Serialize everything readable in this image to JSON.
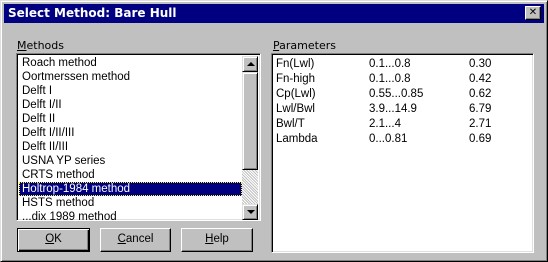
{
  "window": {
    "title": "Select Method: Bare Hull",
    "close_glyph": "✕"
  },
  "methods": {
    "label_accel": "M",
    "label_rest": "ethods",
    "items": [
      "Roach method",
      "Oortmerssen method",
      "Delft I",
      "Delft I/II",
      "Delft II",
      "Delft I/II/III",
      "Delft II/III",
      "USNA YP series",
      "CRTS method",
      "Holtrop-1984 method",
      "HSTS method",
      "...dix 1989 method"
    ],
    "selected_index": 9
  },
  "parameters": {
    "label_accel": "P",
    "label_rest": "arameters",
    "rows": [
      {
        "name": "Fn(Lwl)",
        "range": "0.1...0.8",
        "value": "0.30"
      },
      {
        "name": "Fn-high",
        "range": "0.1...0.8",
        "value": "0.42"
      },
      {
        "name": "Cp(Lwl)",
        "range": "0.55...0.85",
        "value": "0.62"
      },
      {
        "name": "Lwl/Bwl",
        "range": "3.9...14.9",
        "value": "6.79"
      },
      {
        "name": "Bwl/T",
        "range": "2.1...4",
        "value": "2.71"
      },
      {
        "name": "Lambda",
        "range": "0...0.81",
        "value": "0.69"
      }
    ]
  },
  "buttons": {
    "ok": {
      "accel": "O",
      "rest": "K"
    },
    "cancel": {
      "accel": "C",
      "rest": "ancel"
    },
    "help": {
      "accel": "H",
      "rest": "elp"
    }
  },
  "colors": {
    "titlebar": "#000080",
    "face": "#c0c0c0",
    "selection": "#000080"
  }
}
